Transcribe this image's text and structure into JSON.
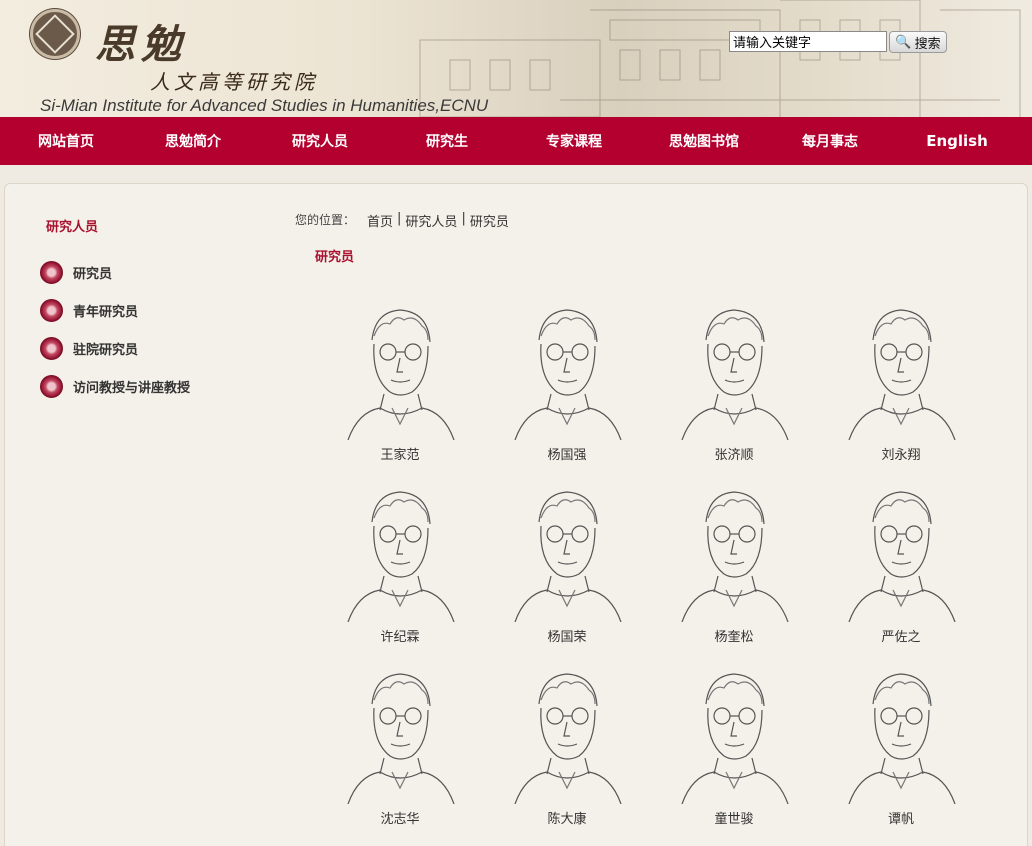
{
  "header": {
    "logo_cn": "思勉",
    "logo_sub": "人文高等研究院",
    "logo_en": "Si-Mian Institute for Advanced Studies in Humanities,ECNU",
    "search_value": "请输入关键字",
    "search_button": "搜索"
  },
  "nav": [
    "网站首页",
    "思勉简介",
    "研究人员",
    "研究生",
    "专家课程",
    "思勉图书馆",
    "每月事志",
    "English"
  ],
  "sidebar": {
    "title": "研究人员",
    "items": [
      "研究员",
      "青年研究员",
      "驻院研究员",
      "访问教授与讲座教授"
    ]
  },
  "breadcrumb": {
    "label": "您的位置：",
    "items": [
      "首页",
      "研究人员",
      "研究员"
    ]
  },
  "section_title": "研究员",
  "people": [
    "王家范",
    "杨国强",
    "张济顺",
    "刘永翔",
    "许纪霖",
    "杨国荣",
    "杨奎松",
    "严佐之",
    "沈志华",
    "陈大康",
    "童世骏",
    "谭帆"
  ],
  "colors": {
    "nav_bg": "#b3002f",
    "accent": "#a8102e"
  }
}
